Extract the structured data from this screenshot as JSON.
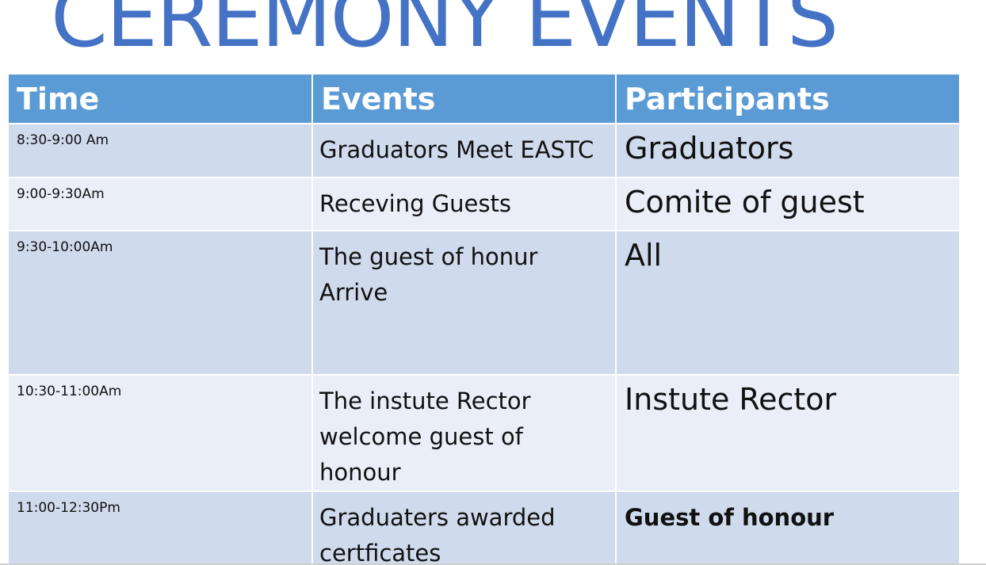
{
  "slide": {
    "title": "CEREMONY EVENTS",
    "title_color": "#4472c4",
    "header_bg": "#5b9bd5",
    "row_bg_odd": "#cfdaec",
    "row_bg_even": "#e9eef7"
  },
  "table": {
    "headers": [
      "Time",
      "Events",
      "Participants"
    ],
    "rows": [
      {
        "time": "8:30-9:00 Am",
        "event": "Graduators Meet EASTC",
        "participants": "Graduators"
      },
      {
        "time": "9:00-9:30Am",
        "event": "Receving Guests",
        "participants": "Comite of guest"
      },
      {
        "time": "9:30-10:00Am",
        "event": "The guest of honur Arrive",
        "participants": "All"
      },
      {
        "time": "10:30-11:00Am",
        "event": "The instute Rector welcome guest of honour",
        "participants": "Instute Rector"
      },
      {
        "time": "11:00-12:30Pm",
        "event": "Graduaters awarded certficates",
        "participants": "Guest of honour"
      }
    ]
  }
}
